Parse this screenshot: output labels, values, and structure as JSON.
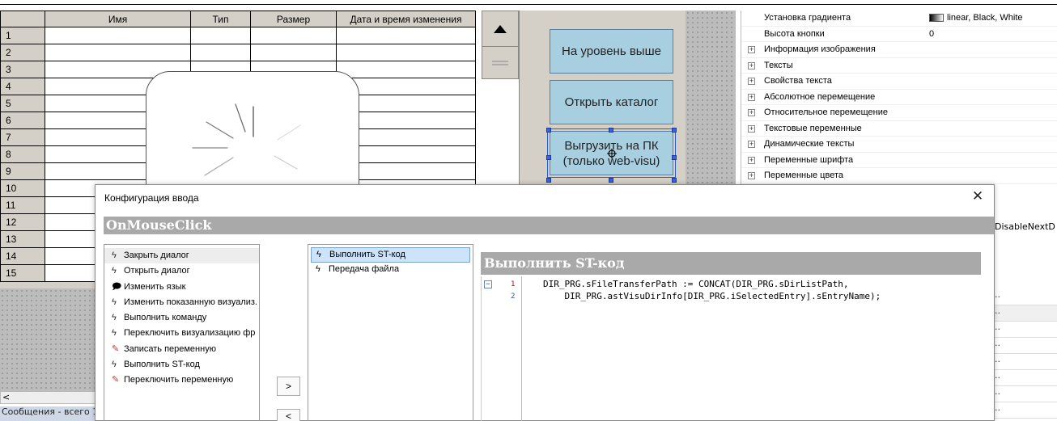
{
  "table": {
    "headers": [
      "",
      "Имя",
      "Тип",
      "Размер",
      "Дата и время изменения"
    ],
    "row_numbers": [
      "1",
      "2",
      "3",
      "4",
      "5",
      "6",
      "7",
      "8",
      "9",
      "10",
      "11",
      "12",
      "13",
      "14",
      "15"
    ]
  },
  "buttons": {
    "level_up": "На уровень выше",
    "open_catalog": "Открыть каталог",
    "download_line1": "Выгрузить на ПК",
    "download_line2": "(только web-visu)"
  },
  "properties": [
    {
      "label": "Установка градиента",
      "value": "linear, Black, White",
      "expander": false,
      "swatch": true
    },
    {
      "label": "Высота кнопки",
      "value": "0",
      "expander": false
    },
    {
      "label": "Информация изображения",
      "expander": true
    },
    {
      "label": "Тексты",
      "expander": true
    },
    {
      "label": "Свойства текста",
      "expander": true
    },
    {
      "label": "Абсолютное перемещение",
      "expander": true
    },
    {
      "label": "Относительное перемещение",
      "expander": true
    },
    {
      "label": "Текстовые переменные",
      "expander": true
    },
    {
      "label": "Динамические тексты",
      "expander": true
    },
    {
      "label": "Переменные шрифта",
      "expander": true
    },
    {
      "label": "Переменные цвета",
      "expander": true
    }
  ],
  "right_strip": {
    "cut_text": "DisableNextD",
    "ellipses": [
      "..",
      "..",
      "..",
      "..",
      "..",
      "..",
      "..",
      ".."
    ]
  },
  "bottom_left": {
    "scroll_char": "<",
    "messages": "Сообщения - всего 1"
  },
  "dialog": {
    "title": "Конфигурация ввода",
    "close": "✕",
    "event": "OnMouseClick",
    "actions": [
      {
        "label": "Закрыть диалог",
        "icon": "ϟ"
      },
      {
        "label": "Открыть диалог",
        "icon": "ϟ"
      },
      {
        "label": "Изменить язык",
        "icon": "🗩"
      },
      {
        "label": "Изменить показанную визуализ.",
        "icon": "ϟ"
      },
      {
        "label": "Выполнить команду",
        "icon": "ϟ"
      },
      {
        "label": "Переключить визуализацию фр",
        "icon": "ϟ"
      },
      {
        "label": "Записать переменную",
        "icon": "✎"
      },
      {
        "label": "Выполнить ST-код",
        "icon": "ϟ"
      },
      {
        "label": "Переключить переменную",
        "icon": "✎"
      }
    ],
    "add_button": ">",
    "remove_button": "<",
    "configured": [
      {
        "label": "Выполнить ST-код",
        "selected": true
      },
      {
        "label": "Передача файла",
        "selected": false
      }
    ],
    "st_header": "Выполнить ST-код",
    "code_lines": [
      {
        "num": "1",
        "text": "DIR_PRG.sFileTransferPath := CONCAT(DIR_PRG.sDirListPath,"
      },
      {
        "num": "2",
        "text": "    DIR_PRG.astVisuDirInfo[DIR_PRG.iSelectedEntry].sEntryName);"
      }
    ]
  },
  "colors": {
    "button_fill": "#a8cfe0",
    "selection_handle": "#3a62d9",
    "header_bar": "#a9a9a9"
  }
}
